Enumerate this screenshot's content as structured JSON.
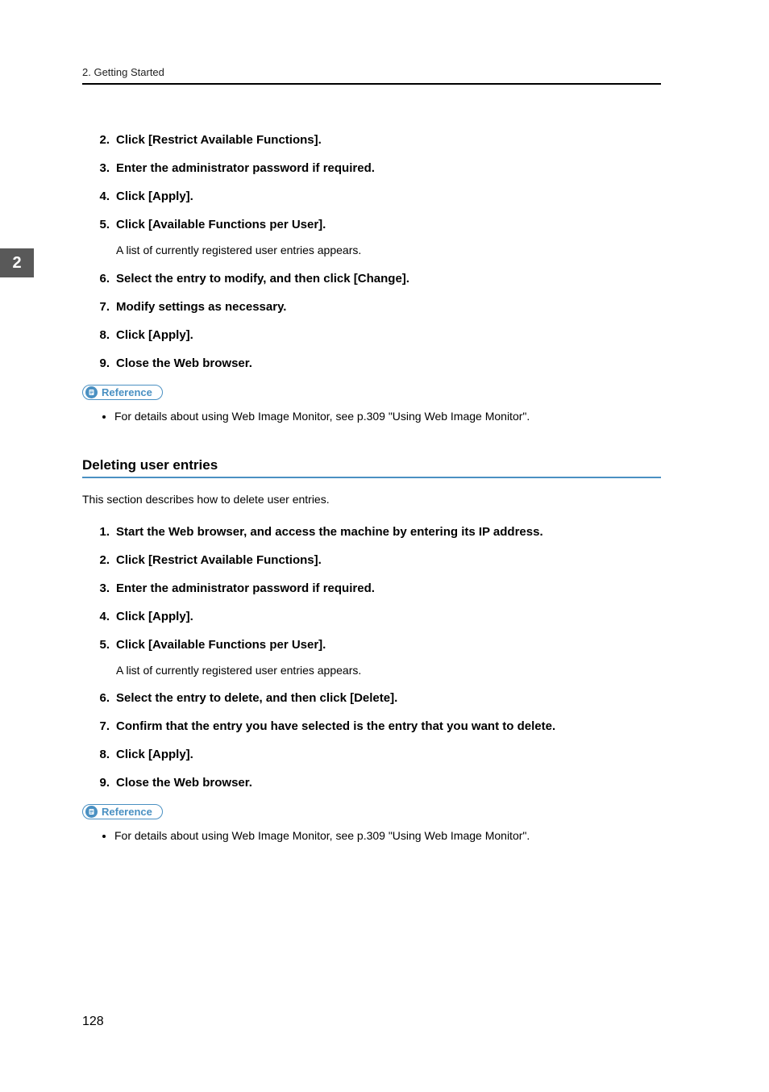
{
  "header": {
    "running_head": "2. Getting Started"
  },
  "section_tab": "2",
  "block_a": {
    "steps": [
      {
        "n": "2.",
        "text": "Click [Restrict Available Functions]."
      },
      {
        "n": "3.",
        "text": "Enter the administrator password if required."
      },
      {
        "n": "4.",
        "text": "Click [Apply]."
      },
      {
        "n": "5.",
        "text": "Click [Available Functions per User].",
        "sub": "A list of currently registered user entries appears."
      },
      {
        "n": "6.",
        "text": "Select the entry to modify, and then click [Change]."
      },
      {
        "n": "7.",
        "text": "Modify settings as necessary."
      },
      {
        "n": "8.",
        "text": "Click [Apply]."
      },
      {
        "n": "9.",
        "text": "Close the Web browser."
      }
    ],
    "ref_label": "Reference",
    "ref_items": [
      "For details about using Web Image Monitor, see p.309 \"Using Web Image Monitor\"."
    ]
  },
  "block_b": {
    "heading": "Deleting user entries",
    "intro": "This section describes how to delete user entries.",
    "steps": [
      {
        "n": "1.",
        "text": "Start the Web browser, and access the machine by entering its IP address."
      },
      {
        "n": "2.",
        "text": "Click [Restrict Available Functions]."
      },
      {
        "n": "3.",
        "text": "Enter the administrator password if required."
      },
      {
        "n": "4.",
        "text": "Click [Apply]."
      },
      {
        "n": "5.",
        "text": "Click [Available Functions per User].",
        "sub": "A list of currently registered user entries appears."
      },
      {
        "n": "6.",
        "text": "Select the entry to delete, and then click [Delete]."
      },
      {
        "n": "7.",
        "text": "Confirm that the entry you have selected is the entry that you want to delete."
      },
      {
        "n": "8.",
        "text": "Click [Apply]."
      },
      {
        "n": "9.",
        "text": "Close the Web browser."
      }
    ],
    "ref_label": "Reference",
    "ref_items": [
      "For details about using Web Image Monitor, see p.309 \"Using Web Image Monitor\"."
    ]
  },
  "page_number": "128"
}
